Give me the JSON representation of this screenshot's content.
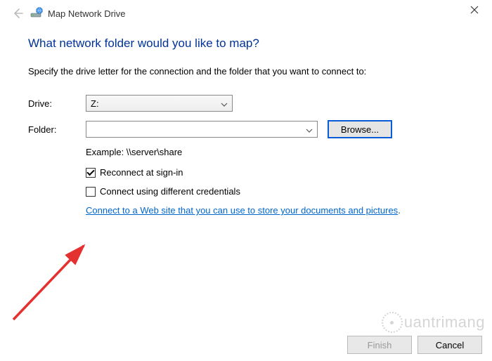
{
  "window": {
    "title": "Map Network Drive"
  },
  "heading": "What network folder would you like to map?",
  "instruction": "Specify the drive letter for the connection and the folder that you want to connect to:",
  "form": {
    "drive_label": "Drive:",
    "drive_value": "Z:",
    "folder_label": "Folder:",
    "folder_value": "",
    "browse_label": "Browse...",
    "example": "Example: \\\\server\\share",
    "reconnect_label": "Reconnect at sign-in",
    "reconnect_checked": true,
    "diff_creds_label": "Connect using different credentials",
    "diff_creds_checked": false,
    "link_text": "Connect to a Web site that you can use to store your documents and pictures"
  },
  "footer": {
    "finish": "Finish",
    "cancel": "Cancel"
  },
  "watermark": "uantrimang"
}
